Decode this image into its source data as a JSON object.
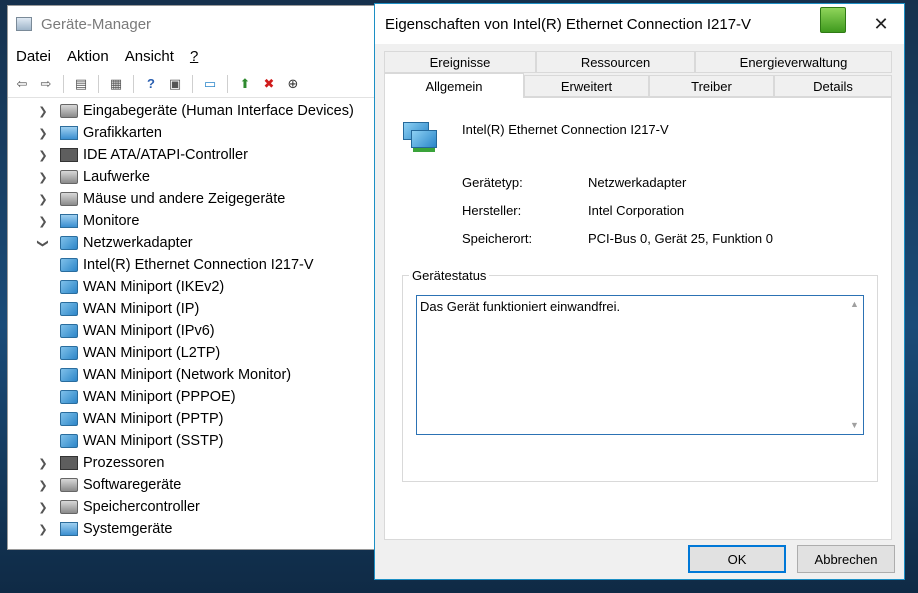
{
  "device_manager": {
    "title": "Geräte-Manager",
    "menu": [
      "Datei",
      "Aktion",
      "Ansicht",
      "?"
    ],
    "tree": [
      {
        "label": "Eingabegeräte (Human Interface Devices)",
        "expanded": false,
        "icon": "input-device-icon",
        "children": []
      },
      {
        "label": "Grafikkarten",
        "expanded": false,
        "icon": "display-adapter-icon",
        "children": []
      },
      {
        "label": "IDE ATA/ATAPI-Controller",
        "expanded": false,
        "icon": "ide-controller-icon",
        "children": []
      },
      {
        "label": "Laufwerke",
        "expanded": false,
        "icon": "disk-drive-icon",
        "children": []
      },
      {
        "label": "Mäuse und andere Zeigegeräte",
        "expanded": false,
        "icon": "mouse-icon",
        "children": []
      },
      {
        "label": "Monitore",
        "expanded": false,
        "icon": "monitor-icon",
        "children": []
      },
      {
        "label": "Netzwerkadapter",
        "expanded": true,
        "icon": "network-adapter-icon",
        "children": [
          "Intel(R) Ethernet Connection I217-V",
          "WAN Miniport (IKEv2)",
          "WAN Miniport (IP)",
          "WAN Miniport (IPv6)",
          "WAN Miniport (L2TP)",
          "WAN Miniport (Network Monitor)",
          "WAN Miniport (PPPOE)",
          "WAN Miniport (PPTP)",
          "WAN Miniport (SSTP)"
        ]
      },
      {
        "label": "Prozessoren",
        "expanded": false,
        "icon": "processor-icon",
        "children": []
      },
      {
        "label": "Softwaregeräte",
        "expanded": false,
        "icon": "software-device-icon",
        "children": []
      },
      {
        "label": "Speichercontroller",
        "expanded": false,
        "icon": "storage-controller-icon",
        "children": []
      },
      {
        "label": "Systemgeräte",
        "expanded": false,
        "icon": "system-device-icon",
        "children": []
      }
    ]
  },
  "dialog": {
    "title": "Eigenschaften von Intel(R) Ethernet Connection I217-V",
    "tabs_top": [
      "Ereignisse",
      "Ressourcen",
      "Energieverwaltung"
    ],
    "tabs_bottom": [
      "Allgemein",
      "Erweitert",
      "Treiber",
      "Details"
    ],
    "active_tab": "Allgemein",
    "device_name": "Intel(R) Ethernet Connection I217-V",
    "properties": [
      {
        "label": "Gerätetyp:",
        "value": "Netzwerkadapter"
      },
      {
        "label": "Hersteller:",
        "value": "Intel Corporation"
      },
      {
        "label": "Speicherort:",
        "value": "PCI-Bus 0, Gerät 25, Funktion 0"
      }
    ],
    "status_label": "Gerätestatus",
    "status_text": "Das Gerät funktioniert einwandfrei.",
    "ok_label": "OK",
    "cancel_label": "Abbrechen"
  }
}
